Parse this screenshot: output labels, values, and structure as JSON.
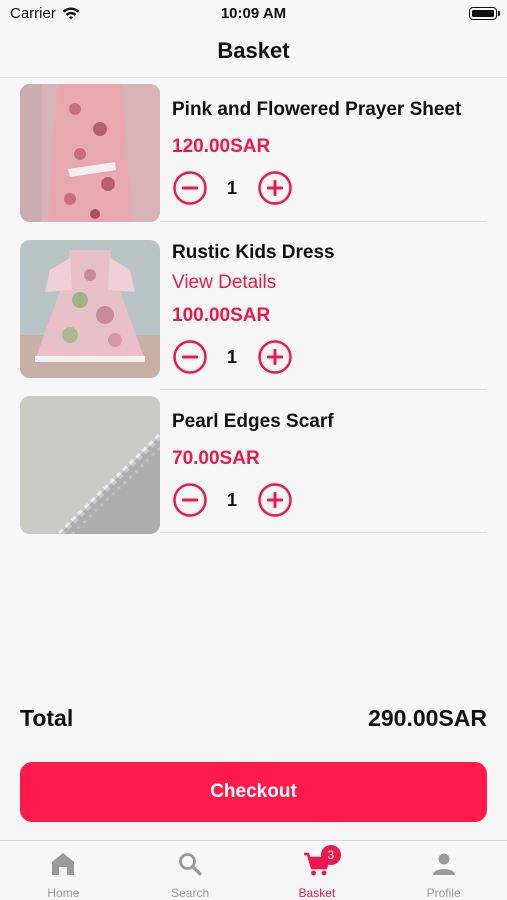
{
  "status_bar": {
    "carrier": "Carrier",
    "time": "10:09 AM"
  },
  "header": {
    "title": "Basket"
  },
  "items": [
    {
      "name": "Pink and Flowered Prayer Sheet",
      "link": "",
      "price": "120.00SAR",
      "qty": "1"
    },
    {
      "name": "Rustic Kids Dress",
      "link": "View Details",
      "price": "100.00SAR",
      "qty": "1"
    },
    {
      "name": "Pearl Edges Scarf",
      "link": "",
      "price": "70.00SAR",
      "qty": "1"
    }
  ],
  "summary": {
    "total_label": "Total",
    "total_value": "290.00SAR"
  },
  "checkout_label": "Checkout",
  "tabs": [
    {
      "label": "Home",
      "icon": "home-icon"
    },
    {
      "label": "Search",
      "icon": "search-icon"
    },
    {
      "label": "Basket",
      "icon": "cart-icon",
      "badge": "3",
      "active": true
    },
    {
      "label": "Profile",
      "icon": "profile-icon"
    }
  ],
  "colors": {
    "accent": "#f0174a",
    "checkout": "#ff1a4b",
    "inactive": "#9a9a9a"
  }
}
